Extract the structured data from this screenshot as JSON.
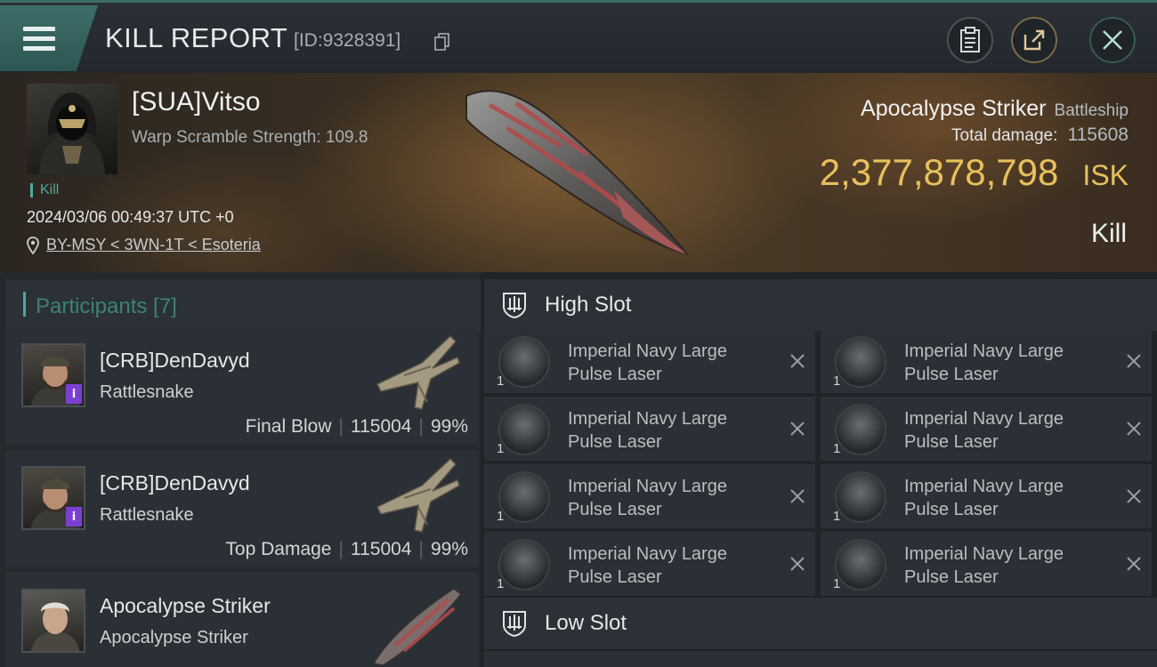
{
  "header": {
    "title": "KILL REPORT",
    "report_id": "[ID:9328391]",
    "icons": [
      "menu-icon",
      "copy-icon",
      "clipboard-icon",
      "share-icon",
      "close-icon"
    ]
  },
  "victim": {
    "name": "[SUA]Vitso",
    "warp_scramble": "Warp Scramble Strength: 109.8",
    "tag": "Kill",
    "timestamp": "2024/03/06 00:49:37 UTC +0",
    "location": "BY-MSY < 3WN-1T < Esoteria",
    "ship_name": "Apocalypse Striker",
    "ship_class": "Battleship",
    "total_damage_label": "Total damage:",
    "total_damage": "115608",
    "isk_value": "2,377,878,798",
    "isk_unit": "ISK",
    "result": "Kill"
  },
  "participants": {
    "title": "Participants [7]",
    "items": [
      {
        "name": "[CRB]DenDavyd",
        "ship": "Rattlesnake",
        "role": "Final Blow",
        "damage": "115004",
        "percent": "99%",
        "badge": "i"
      },
      {
        "name": "[CRB]DenDavyd",
        "ship": "Rattlesnake",
        "role": "Top Damage",
        "damage": "115004",
        "percent": "99%",
        "badge": "i"
      },
      {
        "name": "Apocalypse Striker",
        "ship": "Apocalypse Striker"
      }
    ]
  },
  "fitting": {
    "high_slot": {
      "title": "High Slot",
      "modules": [
        {
          "name": "Imperial Navy Large Pulse Laser",
          "qty": "1"
        },
        {
          "name": "Imperial Navy Large Pulse Laser",
          "qty": "1"
        },
        {
          "name": "Imperial Navy Large Pulse Laser",
          "qty": "1"
        },
        {
          "name": "Imperial Navy Large Pulse Laser",
          "qty": "1"
        },
        {
          "name": "Imperial Navy Large Pulse Laser",
          "qty": "1"
        },
        {
          "name": "Imperial Navy Large Pulse Laser",
          "qty": "1"
        },
        {
          "name": "Imperial Navy Large Pulse Laser",
          "qty": "1"
        },
        {
          "name": "Imperial Navy Large Pulse Laser",
          "qty": "1"
        }
      ]
    },
    "low_slot": {
      "title": "Low Slot"
    }
  },
  "colors": {
    "accent_teal": "#4ea89c",
    "isk_gold": "#e8c05c",
    "badge_purple": "#7b3fd3"
  }
}
